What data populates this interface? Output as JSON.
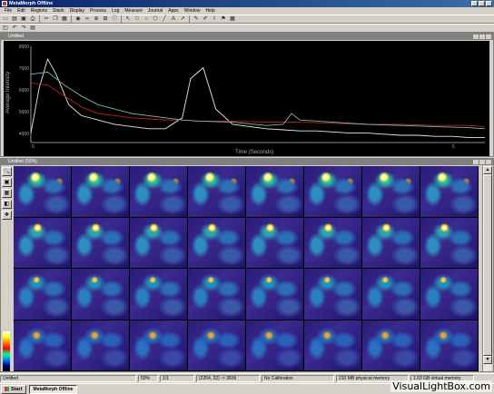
{
  "app": {
    "title": "MetaMorph Offline"
  },
  "menu": [
    "File",
    "Edit",
    "Regions",
    "Stack",
    "Display",
    "Process",
    "Log",
    "Measure",
    "Journal",
    "Apps",
    "Window",
    "Help"
  ],
  "graph_window": {
    "title": "Untitled",
    "ylabel": "Average Intensity",
    "xlabel": "Time (Seconds)",
    "yticks": [
      "8000",
      "7000",
      "6000",
      "5000",
      "4000"
    ],
    "xticks": [
      "0",
      "5"
    ]
  },
  "chart_data": {
    "type": "line",
    "xlabel": "Time (Seconds)",
    "ylabel": "Average Intensity",
    "ylim": [
      3600,
      8000
    ],
    "xlim": [
      0,
      5.4
    ],
    "grid": false,
    "series": [
      {
        "color": "#e8e8e8",
        "x": [
          0,
          0.1,
          0.2,
          0.3,
          0.45,
          0.6,
          0.8,
          1.0,
          1.2,
          1.4,
          1.6,
          1.8,
          1.9,
          2.05,
          2.2,
          2.4,
          2.6,
          2.8,
          3.0,
          3.2,
          3.4,
          3.6,
          3.8,
          4.0,
          4.2,
          4.4,
          4.6,
          4.8,
          5.0,
          5.2,
          5.4
        ],
        "y": [
          4100,
          6200,
          7500,
          6800,
          5400,
          4900,
          4700,
          4500,
          4400,
          4300,
          4300,
          4800,
          6600,
          7100,
          5200,
          4500,
          4400,
          4300,
          4250,
          4200,
          4200,
          4150,
          4100,
          4100,
          4050,
          4000,
          4000,
          3950,
          3950,
          3900,
          3900
        ]
      },
      {
        "color": "#c02020",
        "x": [
          0,
          0.2,
          0.4,
          0.6,
          0.8,
          1.0,
          1.2,
          1.4,
          1.6,
          1.8,
          2.0,
          2.4,
          2.8,
          3.2,
          3.6,
          4.0,
          4.4,
          4.8,
          5.2,
          5.4
        ],
        "y": [
          6400,
          6300,
          5800,
          5300,
          5000,
          4900,
          4800,
          4750,
          4700,
          4700,
          4650,
          4650,
          4600,
          4600,
          4550,
          4500,
          4500,
          4450,
          4450,
          4400
        ]
      },
      {
        "color": "#7ab8a8",
        "x": [
          0,
          0.2,
          0.4,
          0.6,
          0.8,
          1.0,
          1.2,
          1.4,
          1.6,
          1.8,
          2.0,
          2.4,
          2.8,
          3.0,
          3.1,
          3.2,
          3.6,
          4.0,
          4.4,
          4.8,
          5.2,
          5.4
        ],
        "y": [
          6800,
          6900,
          6300,
          5800,
          5400,
          5200,
          5000,
          4900,
          4800,
          4700,
          4650,
          4600,
          4450,
          4500,
          5000,
          4700,
          4600,
          4500,
          4450,
          4400,
          4350,
          4300
        ]
      }
    ]
  },
  "image_window": {
    "title": "Untitled (50%)"
  },
  "statusbar": {
    "name": "Untitled",
    "zoom": "50%",
    "plane": "1/1",
    "coords": "(2264, 32) -> 3836",
    "calibration": "No Calibration",
    "physical_memory": "210 MB physical memory",
    "virtual_memory": "1.03 GB virtual memory"
  },
  "taskbar": {
    "start": "Start",
    "task": "MetaMorph Offline"
  },
  "watermark": "VisualLightBox.com"
}
